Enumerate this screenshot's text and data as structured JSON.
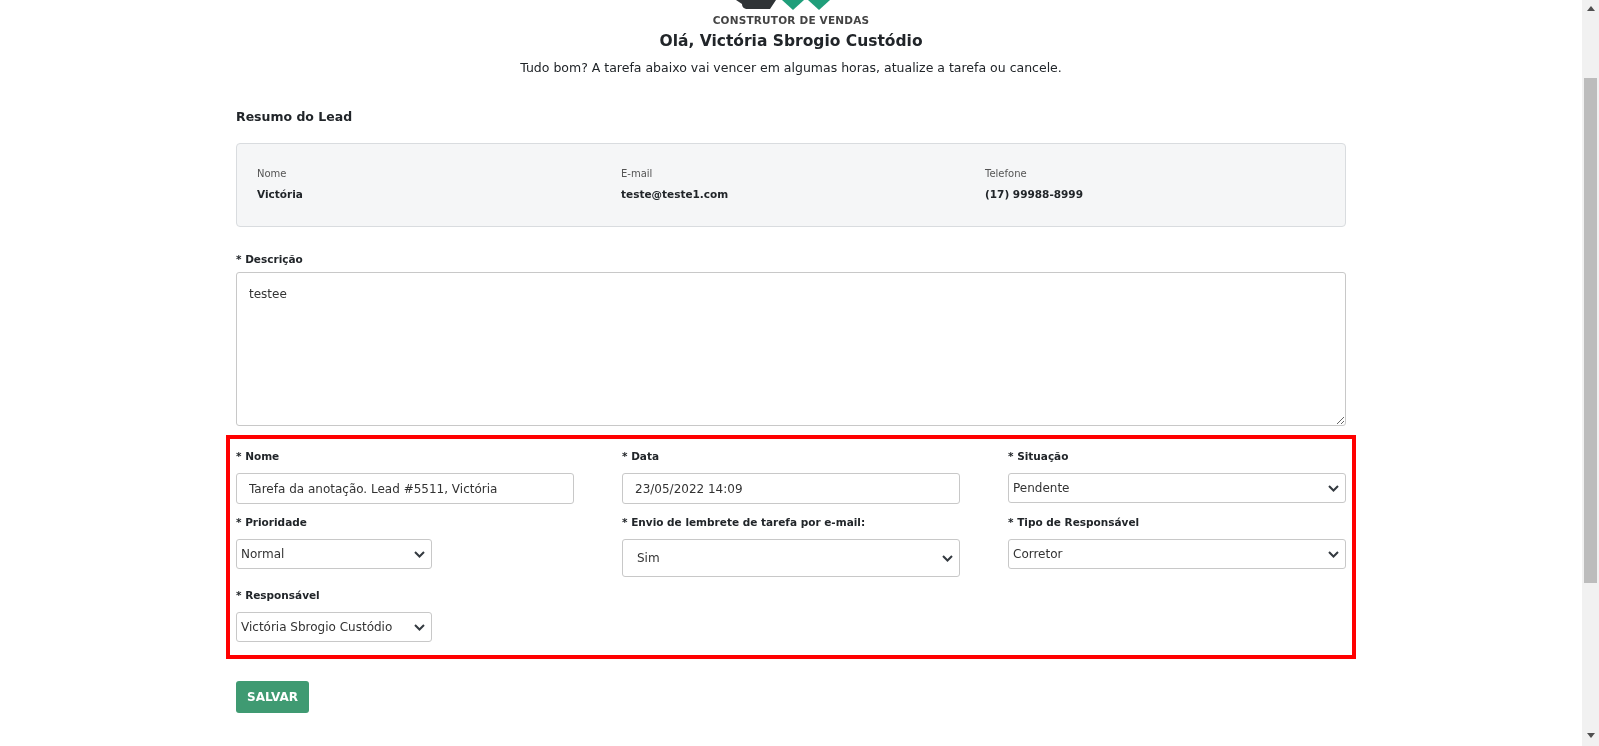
{
  "brand": {
    "tagline": "CONSTRUTOR DE VENDAS"
  },
  "greeting": "Olá, Victória Sbrogio Custódio",
  "message": "Tudo bom? A tarefa abaixo vai vencer em algumas horas, atualize a tarefa ou cancele.",
  "summary": {
    "title": "Resumo do Lead",
    "fields": [
      {
        "label": "Nome",
        "value": "Victória"
      },
      {
        "label": "E-mail",
        "value": "teste@teste1.com"
      },
      {
        "label": "Telefone",
        "value": "(17) 99988-8999"
      }
    ]
  },
  "description": {
    "label": "* Descrição",
    "value": "testee"
  },
  "task_form": {
    "highlighted": true,
    "rows": [
      [
        {
          "kind": "text",
          "label": "* Nome",
          "value": "Tarefa da anotação. Lead #5511, Victória"
        },
        {
          "kind": "text",
          "label": "* Data",
          "value": "23/05/2022 14:09"
        },
        {
          "kind": "select",
          "label": "* Situação",
          "value": "Pendente"
        }
      ],
      [
        {
          "kind": "compact",
          "label": "* Prioridade",
          "value": "Normal"
        },
        {
          "kind": "tall",
          "label": "* Envio de lembrete de tarefa por e-mail:",
          "value": "Sim"
        },
        {
          "kind": "select",
          "label": "* Tipo de Responsável",
          "value": "Corretor"
        }
      ],
      [
        {
          "kind": "compact",
          "label": "* Responsável",
          "value": "Victória Sbrogio Custódio"
        }
      ]
    ]
  },
  "save_button": "SALVAR"
}
